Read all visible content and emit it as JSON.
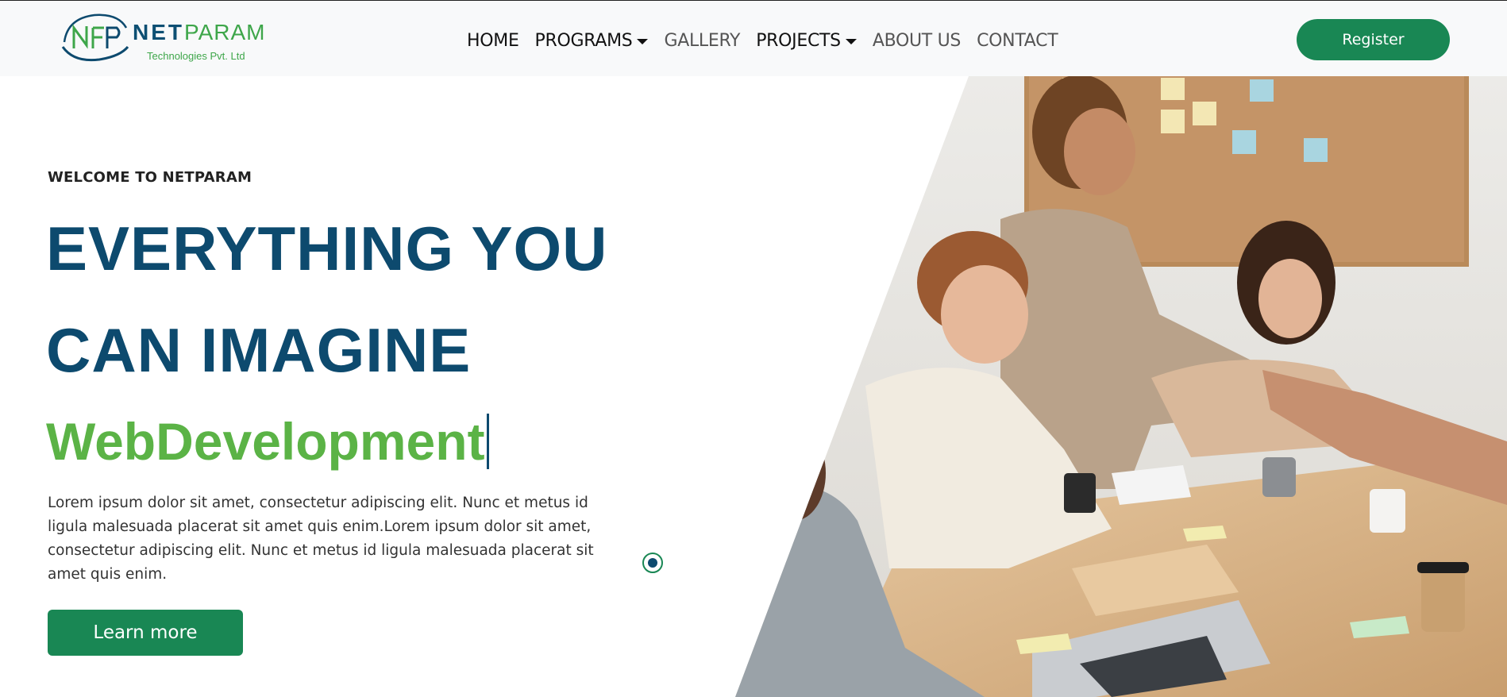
{
  "brand": {
    "name_part1": "NET",
    "name_part2": "PARAM",
    "tagline": "Technologies Pvt. Ltd",
    "logo_icon": "netparam-logo-icon"
  },
  "nav": {
    "items": [
      {
        "label": "HOME",
        "dropdown": false
      },
      {
        "label": "PROGRAMS",
        "dropdown": true
      },
      {
        "label": "GALLERY",
        "dropdown": false
      },
      {
        "label": "PROJECTS",
        "dropdown": true
      },
      {
        "label": "ABOUT US",
        "dropdown": false
      },
      {
        "label": "CONTACT",
        "dropdown": false
      }
    ],
    "register_label": "Register"
  },
  "hero": {
    "eyebrow": "WELCOME TO NETPARAM",
    "headline_line1": "EVERYTHING YOU",
    "headline_line2": "CAN IMAGINE",
    "typed_text": "WebDevelopment",
    "description": "Lorem ipsum dolor sit amet, consectetur adipiscing elit. Nunc et metus id ligula malesuada placerat sit amet quis enim.Lorem ipsum dolor sit amet, consectetur adipiscing elit. Nunc et metus id ligula malesuada placerat sit amet quis enim.",
    "cta_label": "Learn more",
    "image_icon": "team-meeting-photo"
  },
  "colors": {
    "primary_green": "#198754",
    "headline_blue": "#0d4a6e",
    "accent_green": "#5bb346",
    "navbar_bg": "#f8f9fa"
  }
}
